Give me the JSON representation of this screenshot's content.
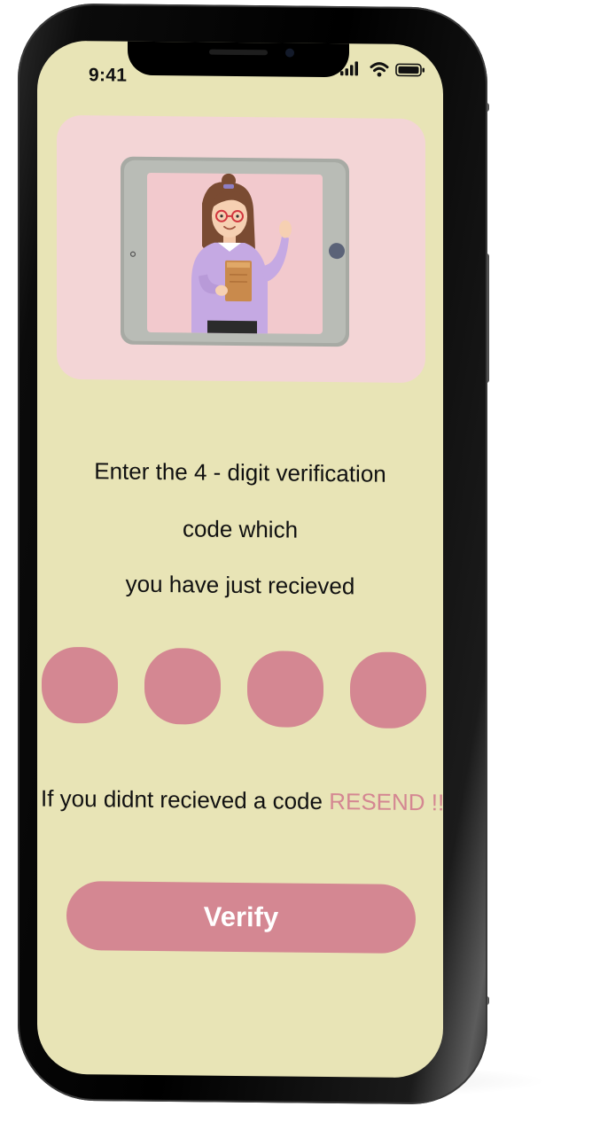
{
  "status_bar": {
    "time": "9:41",
    "icons": [
      "signal-icon",
      "wifi-icon",
      "battery-icon"
    ]
  },
  "hero": {
    "image": "illustration-teacher-in-tablet"
  },
  "instructions": {
    "line1": "Enter the  4 - digit verification",
    "line2": "code which",
    "line3": "you  have just recieved"
  },
  "code_inputs": [
    "",
    "",
    "",
    ""
  ],
  "resend": {
    "prompt": "If you didnt recieved a code ",
    "link_label": "RESEND !!"
  },
  "verify_button": {
    "label": "Verify"
  },
  "colors": {
    "screen_background": "#e8e4b6",
    "accent": "#d48792",
    "hero_background": "#f3d5d6",
    "text": "#111111",
    "button_text": "#ffffff"
  }
}
